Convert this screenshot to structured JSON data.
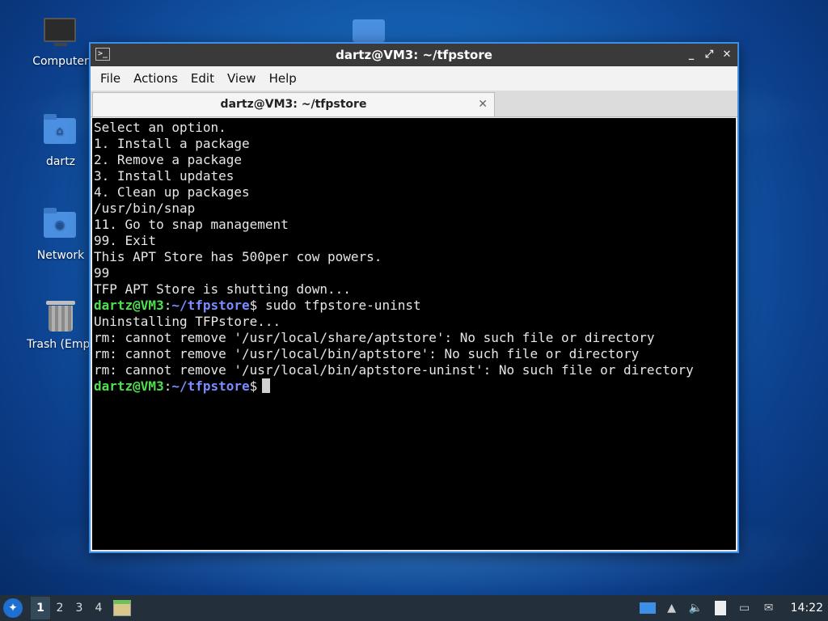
{
  "desktop": {
    "icons": [
      {
        "label": "Computer",
        "icon": "computer-icon"
      },
      {
        "label": "dartz",
        "icon": "home-folder-icon"
      },
      {
        "label": "Network",
        "icon": "network-folder-icon"
      },
      {
        "label": "Trash (Empt",
        "icon": "trash-icon"
      }
    ]
  },
  "window": {
    "title": "dartz@VM3: ~/tfpstore",
    "controls": {
      "minimize": "_",
      "maximize": "⤢",
      "close": "✕"
    },
    "menu": [
      "File",
      "Actions",
      "Edit",
      "View",
      "Help"
    ],
    "tab": {
      "label": "dartz@VM3: ~/tfpstore",
      "close": "✕"
    }
  },
  "terminal": {
    "prompt_user": "dartz@VM3",
    "prompt_sep": ":",
    "prompt_path": "~/tfpstore",
    "prompt_sign": "$",
    "lines": [
      "Select an option.",
      "1. Install a package",
      "2. Remove a package",
      "3. Install updates",
      "4. Clean up packages",
      "/usr/bin/snap",
      "11. Go to snap management",
      "99. Exit",
      "This APT Store has 500per cow powers.",
      "99",
      "TFP APT Store is shutting down..."
    ],
    "command": " sudo tfpstore-uninst",
    "output": [
      "Uninstalling TFPstore...",
      "rm: cannot remove '/usr/local/share/aptstore': No such file or directory",
      "rm: cannot remove '/usr/local/bin/aptstore': No such file or directory",
      "rm: cannot remove '/usr/local/bin/aptstore-uninst': No such file or directory"
    ]
  },
  "taskbar": {
    "workspaces": [
      "1",
      "2",
      "3",
      "4"
    ],
    "active_workspace": "1",
    "clock": "14:22"
  },
  "colors": {
    "prompt_user": "#4ee04e",
    "prompt_path": "#7a8cff",
    "window_border": "#3d8ee6"
  }
}
